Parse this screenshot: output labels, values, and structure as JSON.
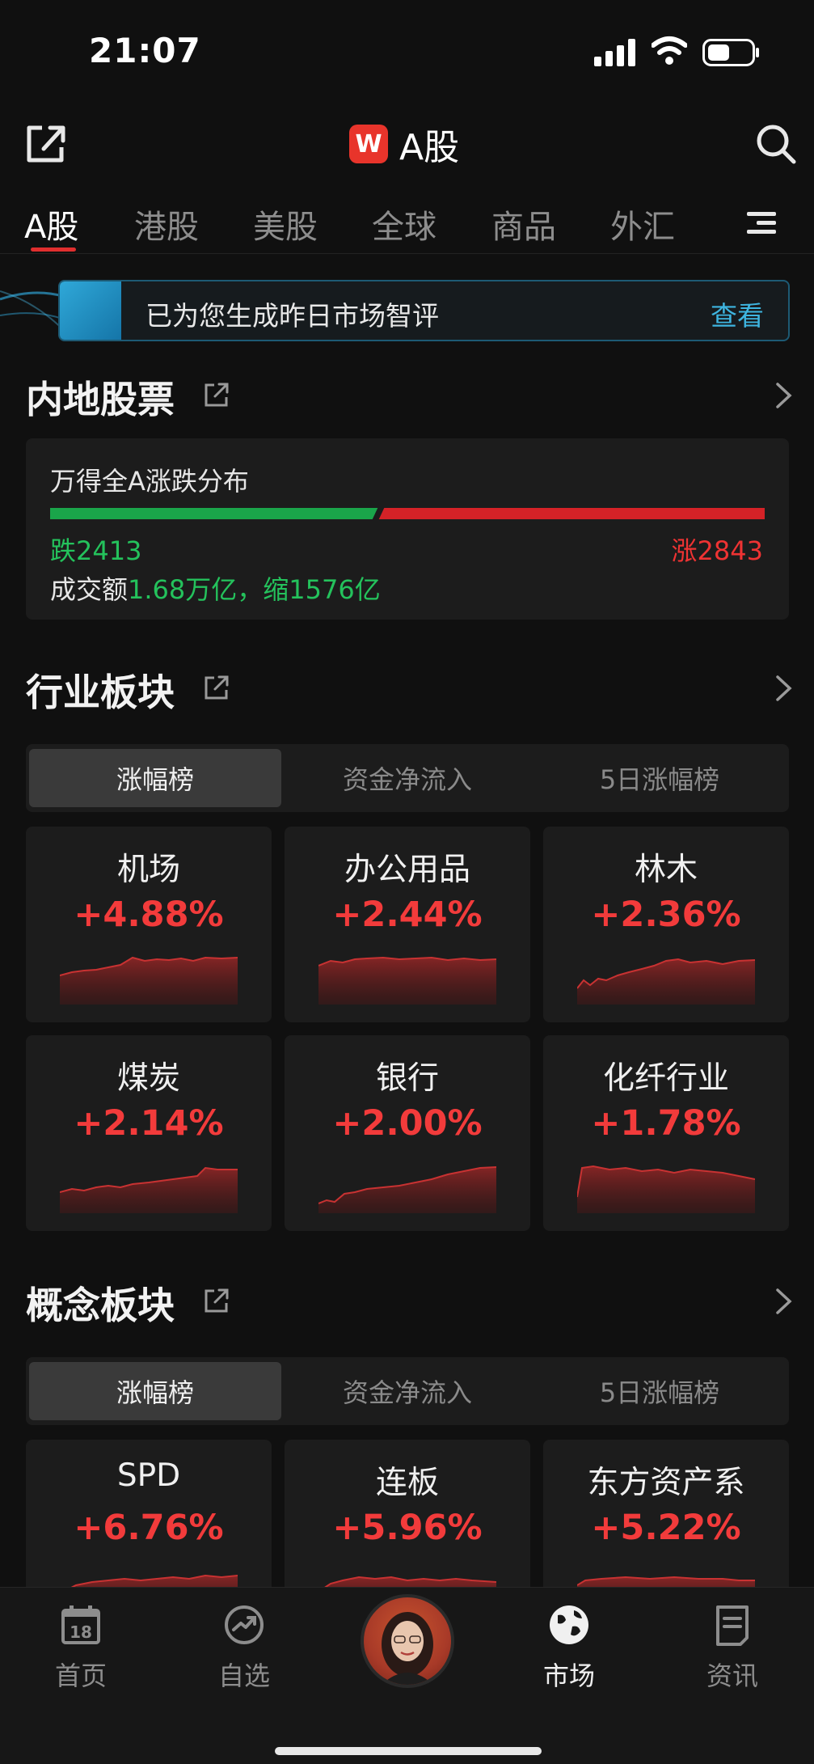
{
  "status_bar": {
    "time": "21:07"
  },
  "header": {
    "title": "A股",
    "logo_letter": "W"
  },
  "tabs": [
    {
      "label": "A股",
      "active": true
    },
    {
      "label": "港股",
      "active": false
    },
    {
      "label": "美股",
      "active": false
    },
    {
      "label": "全球",
      "active": false
    },
    {
      "label": "商品",
      "active": false
    },
    {
      "label": "外汇",
      "active": false
    }
  ],
  "banner": {
    "text": "已为您生成昨日市场智评",
    "link": "查看"
  },
  "mainland": {
    "title": "内地股票",
    "breadth_title": "万得全A涨跌分布",
    "down_count_label": "跌2413",
    "up_count_label": "涨2843",
    "down_count": 2413,
    "up_count": 2843,
    "volume_prefix": "成交额",
    "volume_value": "1.68万亿，缩1576亿"
  },
  "industry": {
    "title": "行业板块",
    "subtabs": [
      "涨幅榜",
      "资金净流入",
      "5日涨幅榜"
    ],
    "tiles": [
      {
        "name": "机场",
        "pct": "+4.88%"
      },
      {
        "name": "办公用品",
        "pct": "+2.44%"
      },
      {
        "name": "林木",
        "pct": "+2.36%"
      },
      {
        "name": "煤炭",
        "pct": "+2.14%"
      },
      {
        "name": "银行",
        "pct": "+2.00%"
      },
      {
        "name": "化纤行业",
        "pct": "+1.78%"
      }
    ]
  },
  "concept": {
    "title": "概念板块",
    "subtabs": [
      "涨幅榜",
      "资金净流入",
      "5日涨幅榜"
    ],
    "tiles": [
      {
        "name": "SPD",
        "pct": "+6.76%"
      },
      {
        "name": "连板",
        "pct": "+5.96%"
      },
      {
        "name": "东方资产系",
        "pct": "+5.22%"
      }
    ]
  },
  "bottom_nav": [
    {
      "label": "首页",
      "icon": "calendar-icon",
      "calendar_day": "18"
    },
    {
      "label": "自选",
      "icon": "trend-icon"
    },
    {
      "label": "",
      "icon": "assistant-avatar"
    },
    {
      "label": "市场",
      "icon": "globe-icon",
      "active": true
    },
    {
      "label": "资讯",
      "icon": "news-icon"
    }
  ],
  "colors": {
    "up": "#f23b3b",
    "down": "#24c25c",
    "accent": "#3eb5e0",
    "brand": "#e8342b"
  }
}
